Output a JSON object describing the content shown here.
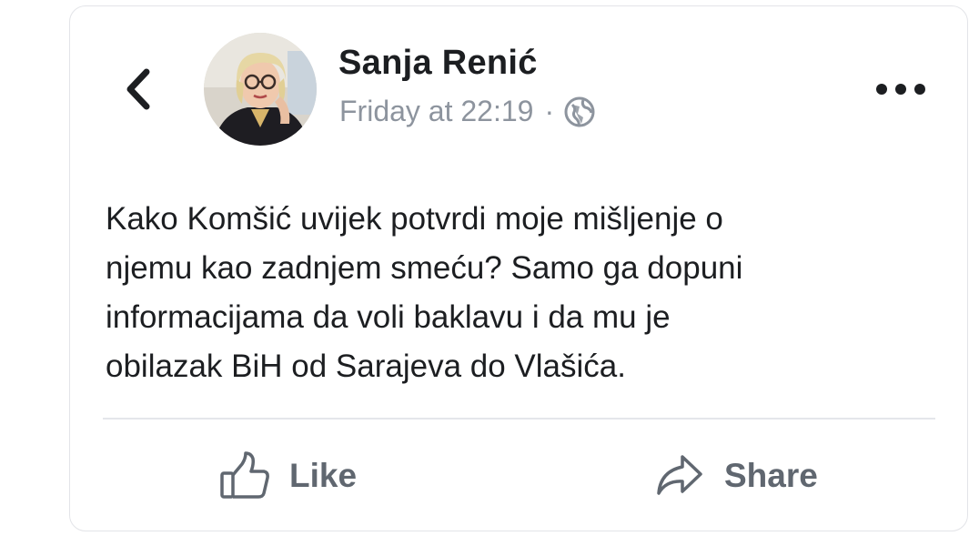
{
  "post": {
    "author": "Sanja Renić",
    "timestamp": "Friday at 22:19",
    "separator": "·",
    "privacy_icon": "globe-icon",
    "text_lines": [
      "Kako Komšić uvijek potvrdi moje mišljenje o",
      "njemu kao zadnjem smeću? Samo ga dopuni",
      "informacijama da voli baklavu i da mu je",
      "obilazak BiH od Sarajeva do Vlašića."
    ]
  },
  "actions": {
    "like_label": "Like",
    "share_label": "Share"
  },
  "icons": {
    "back": "chevron-left-icon",
    "more": "more-dots-icon",
    "like": "thumbs-up-icon",
    "share": "share-arrow-icon"
  },
  "colors": {
    "text": "#1c1e21",
    "secondary_text": "#8d949e",
    "action_text": "#606770",
    "divider": "#e4e6eb"
  }
}
